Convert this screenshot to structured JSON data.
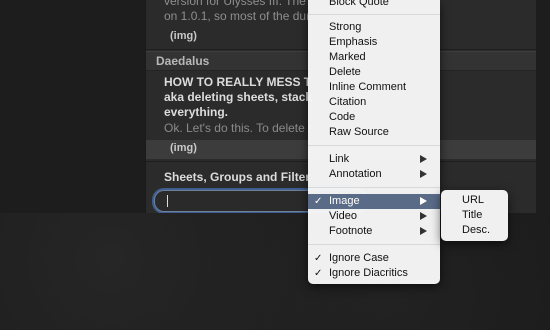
{
  "editor": {
    "prev_sheet": {
      "line1": "version for Ulysses III. The",
      "line2": "on 1.0.1, so most of the dur",
      "img": "(img)"
    },
    "group": "Daedalus",
    "sheet": {
      "title1": "HOW TO REALLY MESS T",
      "title2": "aka deleting sheets, stack",
      "title3": "everything.",
      "body": "Ok. Let's do this. To delete s",
      "img": "(img)"
    },
    "next_sheet_title": "Sheets, Groups and Filter",
    "search_value": ""
  },
  "menu": {
    "top_item": "Block Quote",
    "items_a": [
      "Strong",
      "Emphasis",
      "Marked",
      "Delete",
      "Inline Comment",
      "Citation",
      "Code",
      "Raw Source"
    ],
    "link": "Link",
    "annotation": "Annotation",
    "image": "Image",
    "video": "Video",
    "footnote": "Footnote",
    "ignore_case": "Ignore Case",
    "ignore_diacritics": "Ignore Diacritics",
    "check": "✓"
  },
  "submenu": {
    "items": [
      "URL",
      "Title",
      "Desc."
    ]
  }
}
